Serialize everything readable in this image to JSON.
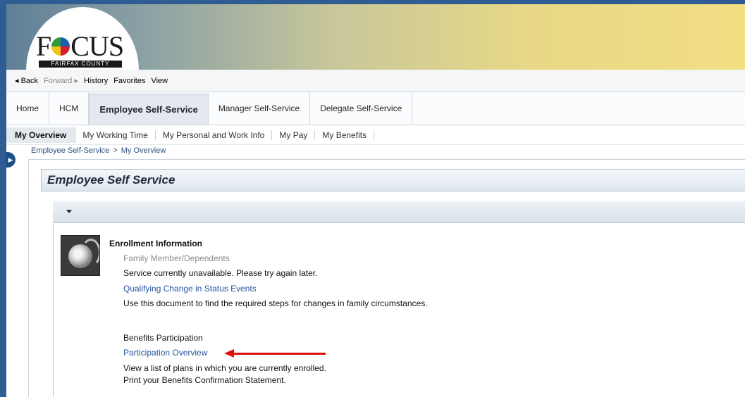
{
  "logo": {
    "title": "FOCUS",
    "subtitle": "FAIRFAX COUNTY"
  },
  "history_bar": {
    "back": "◂ Back",
    "forward": "Forward ▸",
    "history": "History",
    "favorites": "Favorites",
    "view": "View"
  },
  "tabs1": [
    {
      "label": "Home"
    },
    {
      "label": "HCM"
    },
    {
      "label": "Employee Self-Service",
      "active": true
    },
    {
      "label": "Manager Self-Service"
    },
    {
      "label": "Delegate Self-Service"
    }
  ],
  "tabs2": [
    {
      "label": "My Overview",
      "active": true
    },
    {
      "label": "My Working Time"
    },
    {
      "label": "My Personal and Work Info"
    },
    {
      "label": "My Pay"
    },
    {
      "label": "My Benefits"
    }
  ],
  "breadcrumb": {
    "parent": "Employee Self-Service",
    "separator": ">",
    "current": "My Overview"
  },
  "page": {
    "title": "Employee Self Service"
  },
  "enrollment": {
    "heading": "Enrollment Information",
    "family_link": "Family Member/Dependents",
    "family_desc": "Service currently unavailable. Please try again later.",
    "qualifying_link": "Qualifying Change in Status Events",
    "qualifying_desc": "Use this document to find the required steps for changes in family circumstances."
  },
  "benefits": {
    "heading": "Benefits Participation",
    "overview_link": "Participation Overview",
    "overview_desc1": "View a list of plans in which you are currently enrolled.",
    "overview_desc2": "Print your Benefits Confirmation Statement."
  },
  "colors": {
    "link": "#2656a3",
    "annotation_arrow": "#e01010",
    "header_blue": "#2f5d93"
  }
}
